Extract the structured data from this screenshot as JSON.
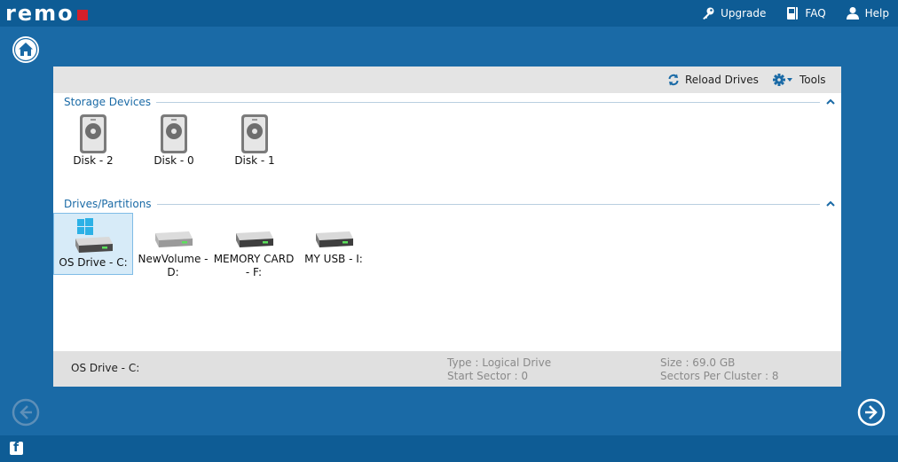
{
  "app": {
    "logo_text": "remo"
  },
  "topnav": {
    "upgrade_label": "Upgrade",
    "faq_label": "FAQ",
    "help_label": "Help"
  },
  "toolbar": {
    "reload_label": "Reload Drives",
    "tools_label": "Tools"
  },
  "storage": {
    "title": "Storage Devices",
    "disks": [
      {
        "label": "Disk - 2"
      },
      {
        "label": "Disk - 0"
      },
      {
        "label": "Disk - 1"
      }
    ]
  },
  "partitions": {
    "title": "Drives/Partitions",
    "drives": [
      {
        "label": "OS Drive - C:",
        "selected": true
      },
      {
        "label": "NewVolume - D:"
      },
      {
        "label": "MEMORY CARD - F:",
        "line1": "MEMORY CARD",
        "line2": "- F:"
      },
      {
        "label": "MY USB - I:"
      }
    ]
  },
  "status": {
    "name": "OS Drive - C:",
    "type": "Type : Logical Drive",
    "start_sector": "Start Sector : 0",
    "size": "Size : 69.0 GB",
    "sectors_per_cluster": "Sectors Per Cluster : 8"
  },
  "colors": {
    "background": "#1a6aa6",
    "bar": "#0e5c95",
    "accent": "#1a6aa6",
    "logo_red": "#d41f2a",
    "selected": "#d7ebf8"
  },
  "icons": [
    "key-icon",
    "book-icon",
    "user-icon",
    "home-icon",
    "reload-icon",
    "gear-icon",
    "disk-icon",
    "drive-icon",
    "windows-icon",
    "back-arrow-icon",
    "next-arrow-icon",
    "facebook-icon",
    "collapse-icon"
  ]
}
